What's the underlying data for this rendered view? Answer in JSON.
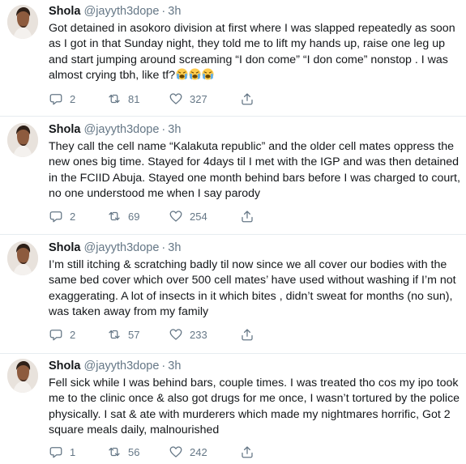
{
  "tweets": [
    {
      "name": "Shola",
      "handle": "@jayyth3dope",
      "separator": "·",
      "time": "3h",
      "text": "Got detained in asokoro division at first where I was slapped repeatedly as soon as I got in that Sunday night, they told me to lift my hands up, raise one leg up and start jumping around screaming “I don come” “I don come” nonstop . I was almost crying tbh, like tf?",
      "emoji": [
        "loudly-crying-face",
        "loudly-crying-face",
        "loudly-crying-face"
      ],
      "replies": "2",
      "retweets": "81",
      "likes": "327"
    },
    {
      "name": "Shola",
      "handle": "@jayyth3dope",
      "separator": "·",
      "time": "3h",
      "text": "They call the cell name “Kalakuta republic” and the older cell mates oppress the new ones big time. Stayed for 4days til I met with the IGP and was then detained in the FCIID Abuja. Stayed one month behind bars before I was charged to court, no one understood me when I say parody",
      "replies": "2",
      "retweets": "69",
      "likes": "254"
    },
    {
      "name": "Shola",
      "handle": "@jayyth3dope",
      "separator": "·",
      "time": "3h",
      "text": "I’m still itching & scratching badly til now since we all cover our bodies with the same bed cover which over 500 cell mates’ have used without washing if I’m not exaggerating. A lot of insects in it which bites , didn’t sweat for months (no sun), was taken away from my family",
      "replies": "2",
      "retweets": "57",
      "likes": "233"
    },
    {
      "name": "Shola",
      "handle": "@jayyth3dope",
      "separator": "·",
      "time": "3h",
      "text": "Fell sick while I was behind bars, couple times. I was treated tho cos my ipo took me to the clinic once & also got drugs for me once, I wasn’t tortured by the police physically. I sat & ate with murderers which made my nightmares horrific, Got 2 square meals daily, malnourished",
      "replies": "1",
      "retweets": "56",
      "likes": "242"
    }
  ],
  "icons": {
    "reply": "reply-icon",
    "retweet": "retweet-icon",
    "like": "like-icon",
    "share": "share-icon"
  },
  "colors": {
    "text": "#14171a",
    "secondary": "#657786",
    "divider": "#e6ecf0",
    "background": "#ffffff"
  }
}
